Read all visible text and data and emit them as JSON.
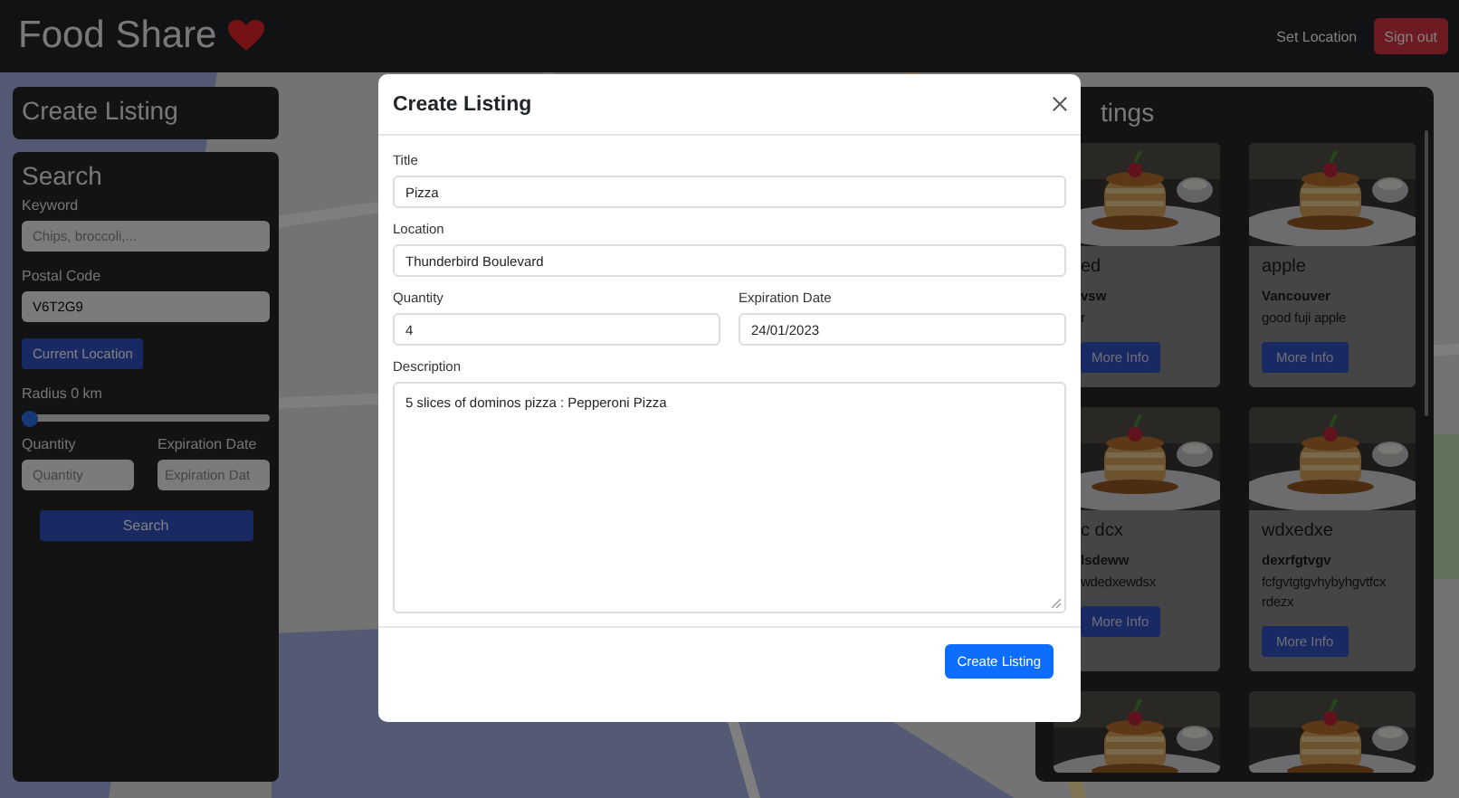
{
  "header": {
    "brand": "Food Share",
    "nav_link": "Set Location",
    "sign_out": "Sign out"
  },
  "create_panel": {
    "title": "Create Listing"
  },
  "search": {
    "title": "Search",
    "keyword": {
      "label": "Keyword",
      "placeholder": "Chips, broccoli,..."
    },
    "postal": {
      "label": "Postal Code",
      "value": "V6T2G9"
    },
    "current_location": "Current Location",
    "radius": {
      "label": "Radius 0 km",
      "level": 0
    },
    "quantity": {
      "label": "Quantity",
      "placeholder": "Quantity"
    },
    "expiration": {
      "label": "Expiration Date",
      "placeholder": "Expiration Dat"
    },
    "button": "Search"
  },
  "listings": {
    "title": "tings",
    "cards": [
      {
        "kind": "covered",
        "title": "ed",
        "place": "vsw",
        "description": "r",
        "button": "More Info"
      },
      {
        "kind": "full",
        "title": "apple",
        "place": "Vancouver",
        "description": "good fuji apple",
        "button": "More Info"
      },
      {
        "kind": "covered",
        "title": "c dcx",
        "place": "lsdeww",
        "description": "wdedxewdsx",
        "button": "More Info"
      },
      {
        "kind": "full",
        "title": "wdxedxe",
        "place": "dexrfgtvgv",
        "description": "fcfgvtgtgvhybyhgvtfcx rdezx",
        "button": "More Info"
      },
      {
        "kind": "image_only"
      },
      {
        "kind": "image_only"
      }
    ]
  },
  "modal": {
    "title": "Create Listing",
    "fields": [
      {
        "label": "Title",
        "value": "Pizza"
      },
      {
        "label": "Location",
        "value": "Thunderbird Boulevard"
      }
    ],
    "row": [
      {
        "label": "Quantity",
        "value": "4"
      },
      {
        "label": "Expiration Date",
        "value": "24/01/2023"
      }
    ],
    "description": {
      "label": "Description",
      "value": "5 slices of dominos pizza : Pepperoni Pizza"
    },
    "submit": "Create Listing"
  }
}
